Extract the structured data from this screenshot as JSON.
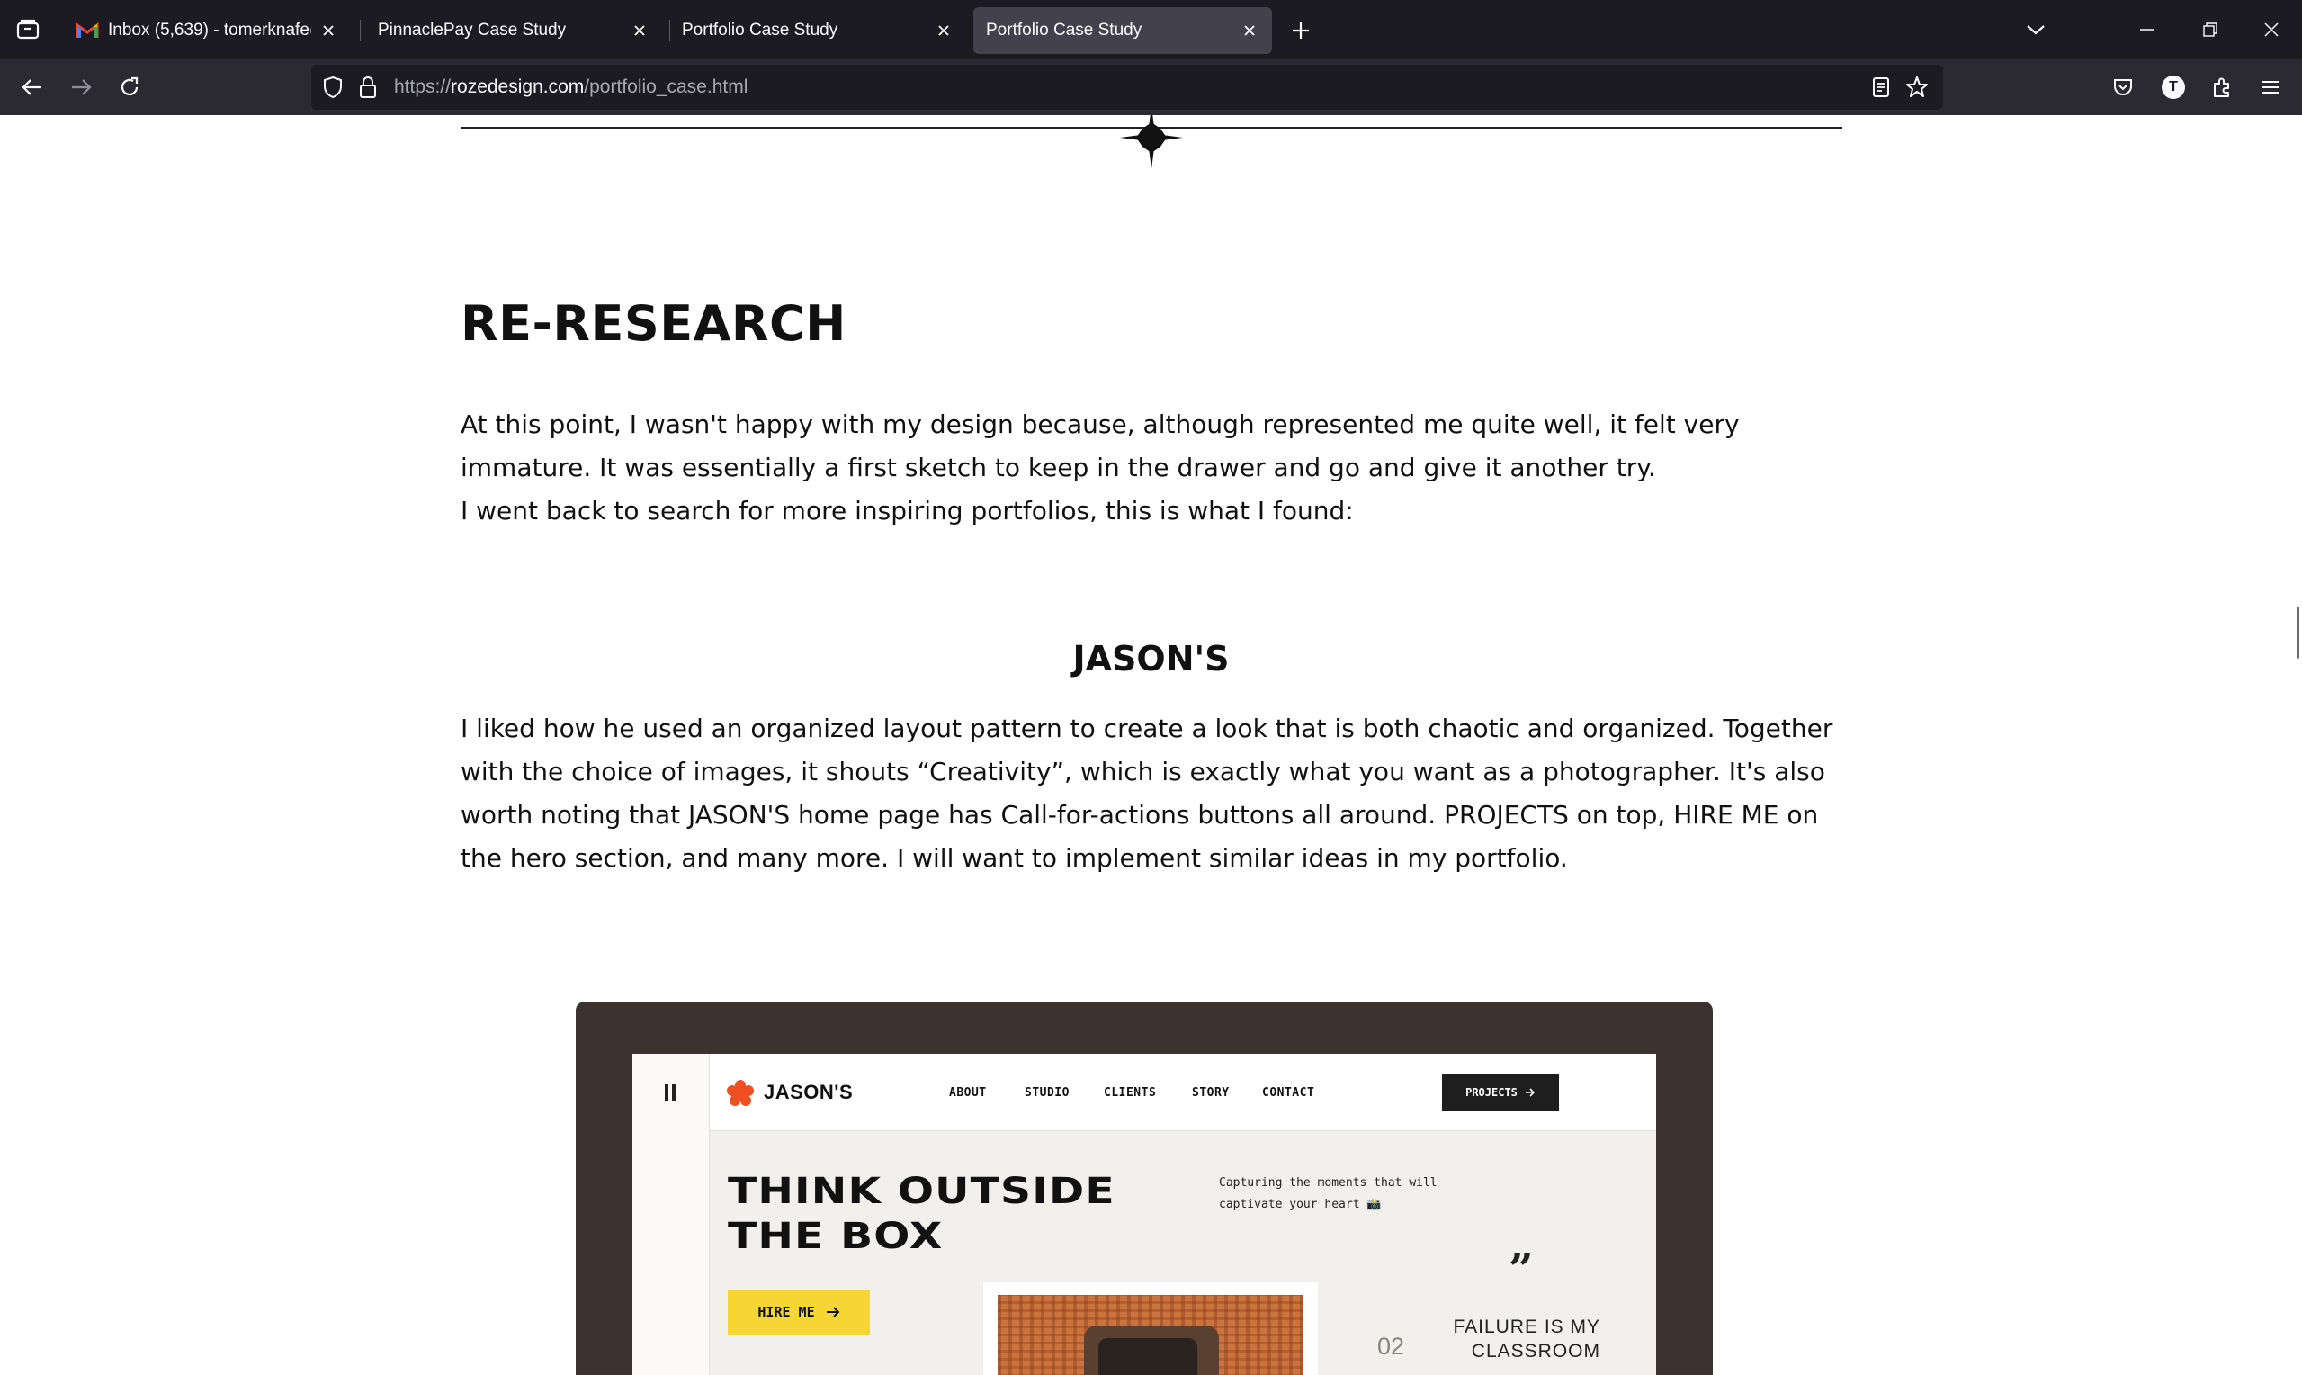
{
  "browser": {
    "tabs": [
      {
        "title": "Inbox (5,639) - tomerknafe@gm",
        "favicon": "gmail-icon",
        "active": false
      },
      {
        "title": "PinnaclePay Case Study",
        "favicon": "none",
        "active": false
      },
      {
        "title": "Portfolio Case Study",
        "favicon": "none",
        "active": false
      },
      {
        "title": "Portfolio Case Study",
        "favicon": "none",
        "active": true
      }
    ],
    "url": {
      "scheme": "https://",
      "host": "rozedesign.com",
      "path": "/portfolio_case.html"
    },
    "profile_initial": "T"
  },
  "article": {
    "section_title": "RE-RESEARCH",
    "intro_lines": [
      "At this point, I wasn't happy with my design because, although represented me quite well, it felt very immature. It was essentially a first sketch to keep in the drawer and go and give it another try.",
      "I went back to search for more inspiring portfolios, this is what I found:"
    ],
    "example_title": "JASON'S",
    "example_text": "I liked how he used an organized layout pattern to create a look that is both chaotic and organized. Together with the choice of images, it shouts “Creativity”, which is exactly what you want as a photographer. It's also worth noting that JASON'S home page has Call-for-actions buttons all around. PROJECTS on top, HIRE ME on the hero section, and many more. I will want to implement similar ideas in my portfolio."
  },
  "jason_site": {
    "logo": "JASON'S",
    "nav": [
      "ABOUT",
      "STUDIO",
      "CLIENTS",
      "STORY",
      "CONTACT"
    ],
    "projects_button": "PROJECTS",
    "hero_title_lines": [
      "THINK OUTSIDE",
      "THE BOX"
    ],
    "caption_lines": [
      "Capturing the moments that will",
      "captivate your heart 📸"
    ],
    "hire_button": "HIRE ME",
    "quote_mark": "”",
    "counter": "02",
    "quote_lines": [
      "FAILURE IS MY",
      "CLASSROOM"
    ],
    "colors": {
      "accent_yellow": "#f6d635",
      "logo_orange": "#f04e23",
      "frame_brown": "#3c3330"
    }
  }
}
